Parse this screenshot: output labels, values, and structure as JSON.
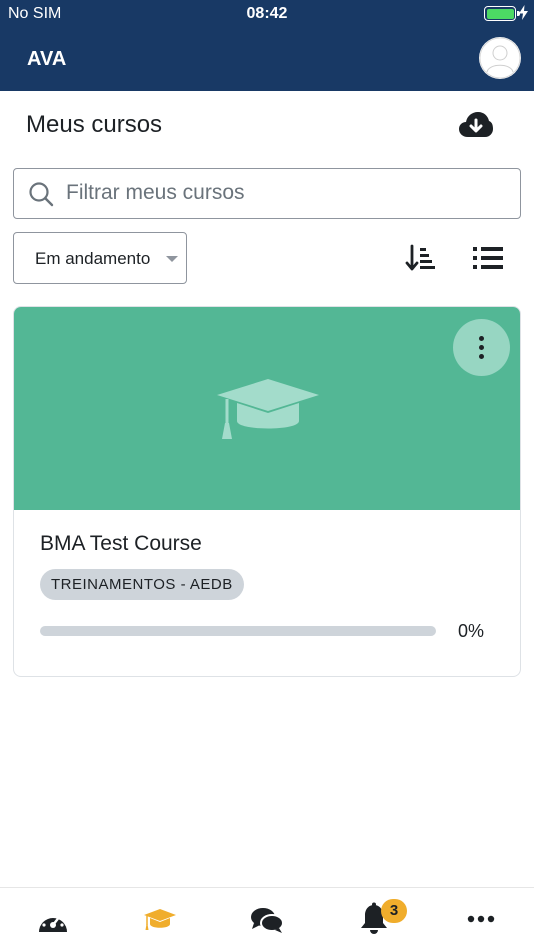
{
  "status_bar": {
    "carrier": "No SIM",
    "time": "08:42"
  },
  "header": {
    "title": "AVA"
  },
  "page": {
    "title": "Meus cursos"
  },
  "search": {
    "placeholder": "Filtrar meus cursos",
    "value": ""
  },
  "filter": {
    "selected": "Em andamento"
  },
  "course": {
    "name": "BMA Test Course",
    "category": "TREINAMENTOS - AEDB",
    "progress_text": "0%",
    "progress_percent": 0
  },
  "tabs": [
    {
      "name": "dashboard",
      "icon": "gauge-icon",
      "active": false
    },
    {
      "name": "my-courses",
      "icon": "graduation-cap-icon",
      "active": true
    },
    {
      "name": "messages",
      "icon": "comments-icon",
      "active": false
    },
    {
      "name": "notifications",
      "icon": "bell-icon",
      "active": false,
      "badge": "3"
    },
    {
      "name": "more",
      "icon": "ellipsis-icon",
      "active": false
    }
  ],
  "colors": {
    "header_bg": "#183965",
    "banner": "#53b795",
    "active_tab": "#f0ad2c",
    "badge": "#f0ad2c"
  }
}
